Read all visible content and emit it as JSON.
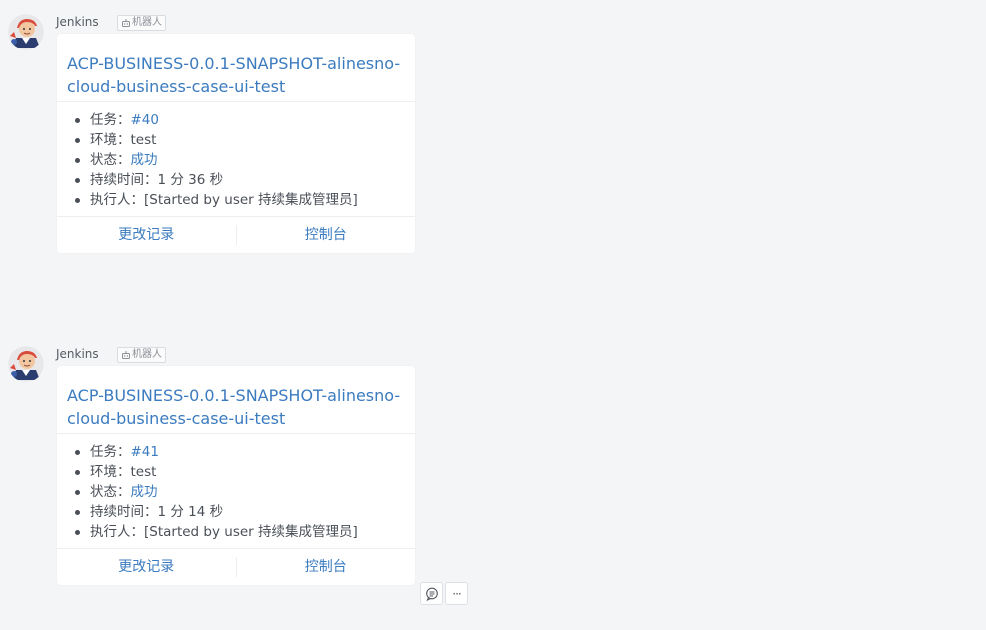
{
  "messages": [
    {
      "sender": "Jenkins",
      "badge": "机器人",
      "title": "ACP-BUSINESS-0.0.1-SNAPSHOT-alinesno-cloud-business-case-ui-test",
      "rows": [
        {
          "label": "任务：",
          "value": "#40"
        },
        {
          "label": "环境：",
          "value": "test"
        },
        {
          "label": "状态：",
          "value": "成功"
        },
        {
          "label": "持续时间：",
          "value": "1 分 36 秒"
        },
        {
          "label": "执行人：",
          "value": "[Started by user 持续集成管理员]"
        }
      ],
      "buttons": {
        "changes": "更改记录",
        "console": "控制台"
      }
    },
    {
      "sender": "Jenkins",
      "badge": "机器人",
      "title": "ACP-BUSINESS-0.0.1-SNAPSHOT-alinesno-cloud-business-case-ui-test",
      "rows": [
        {
          "label": "任务：",
          "value": "#41"
        },
        {
          "label": "环境：",
          "value": "test"
        },
        {
          "label": "状态：",
          "value": "成功"
        },
        {
          "label": "持续时间：",
          "value": "1 分 14 秒"
        },
        {
          "label": "执行人：",
          "value": "[Started by user 持续集成管理员]"
        }
      ],
      "buttons": {
        "changes": "更改记录",
        "console": "控制台"
      }
    }
  ],
  "hover_tools": {
    "reply_icon": "reply-bubble-icon",
    "more_label": "···"
  },
  "colors": {
    "link": "#3b7bbf",
    "text": "#4a4f57",
    "background": "#f4f5f7",
    "card": "#ffffff"
  }
}
